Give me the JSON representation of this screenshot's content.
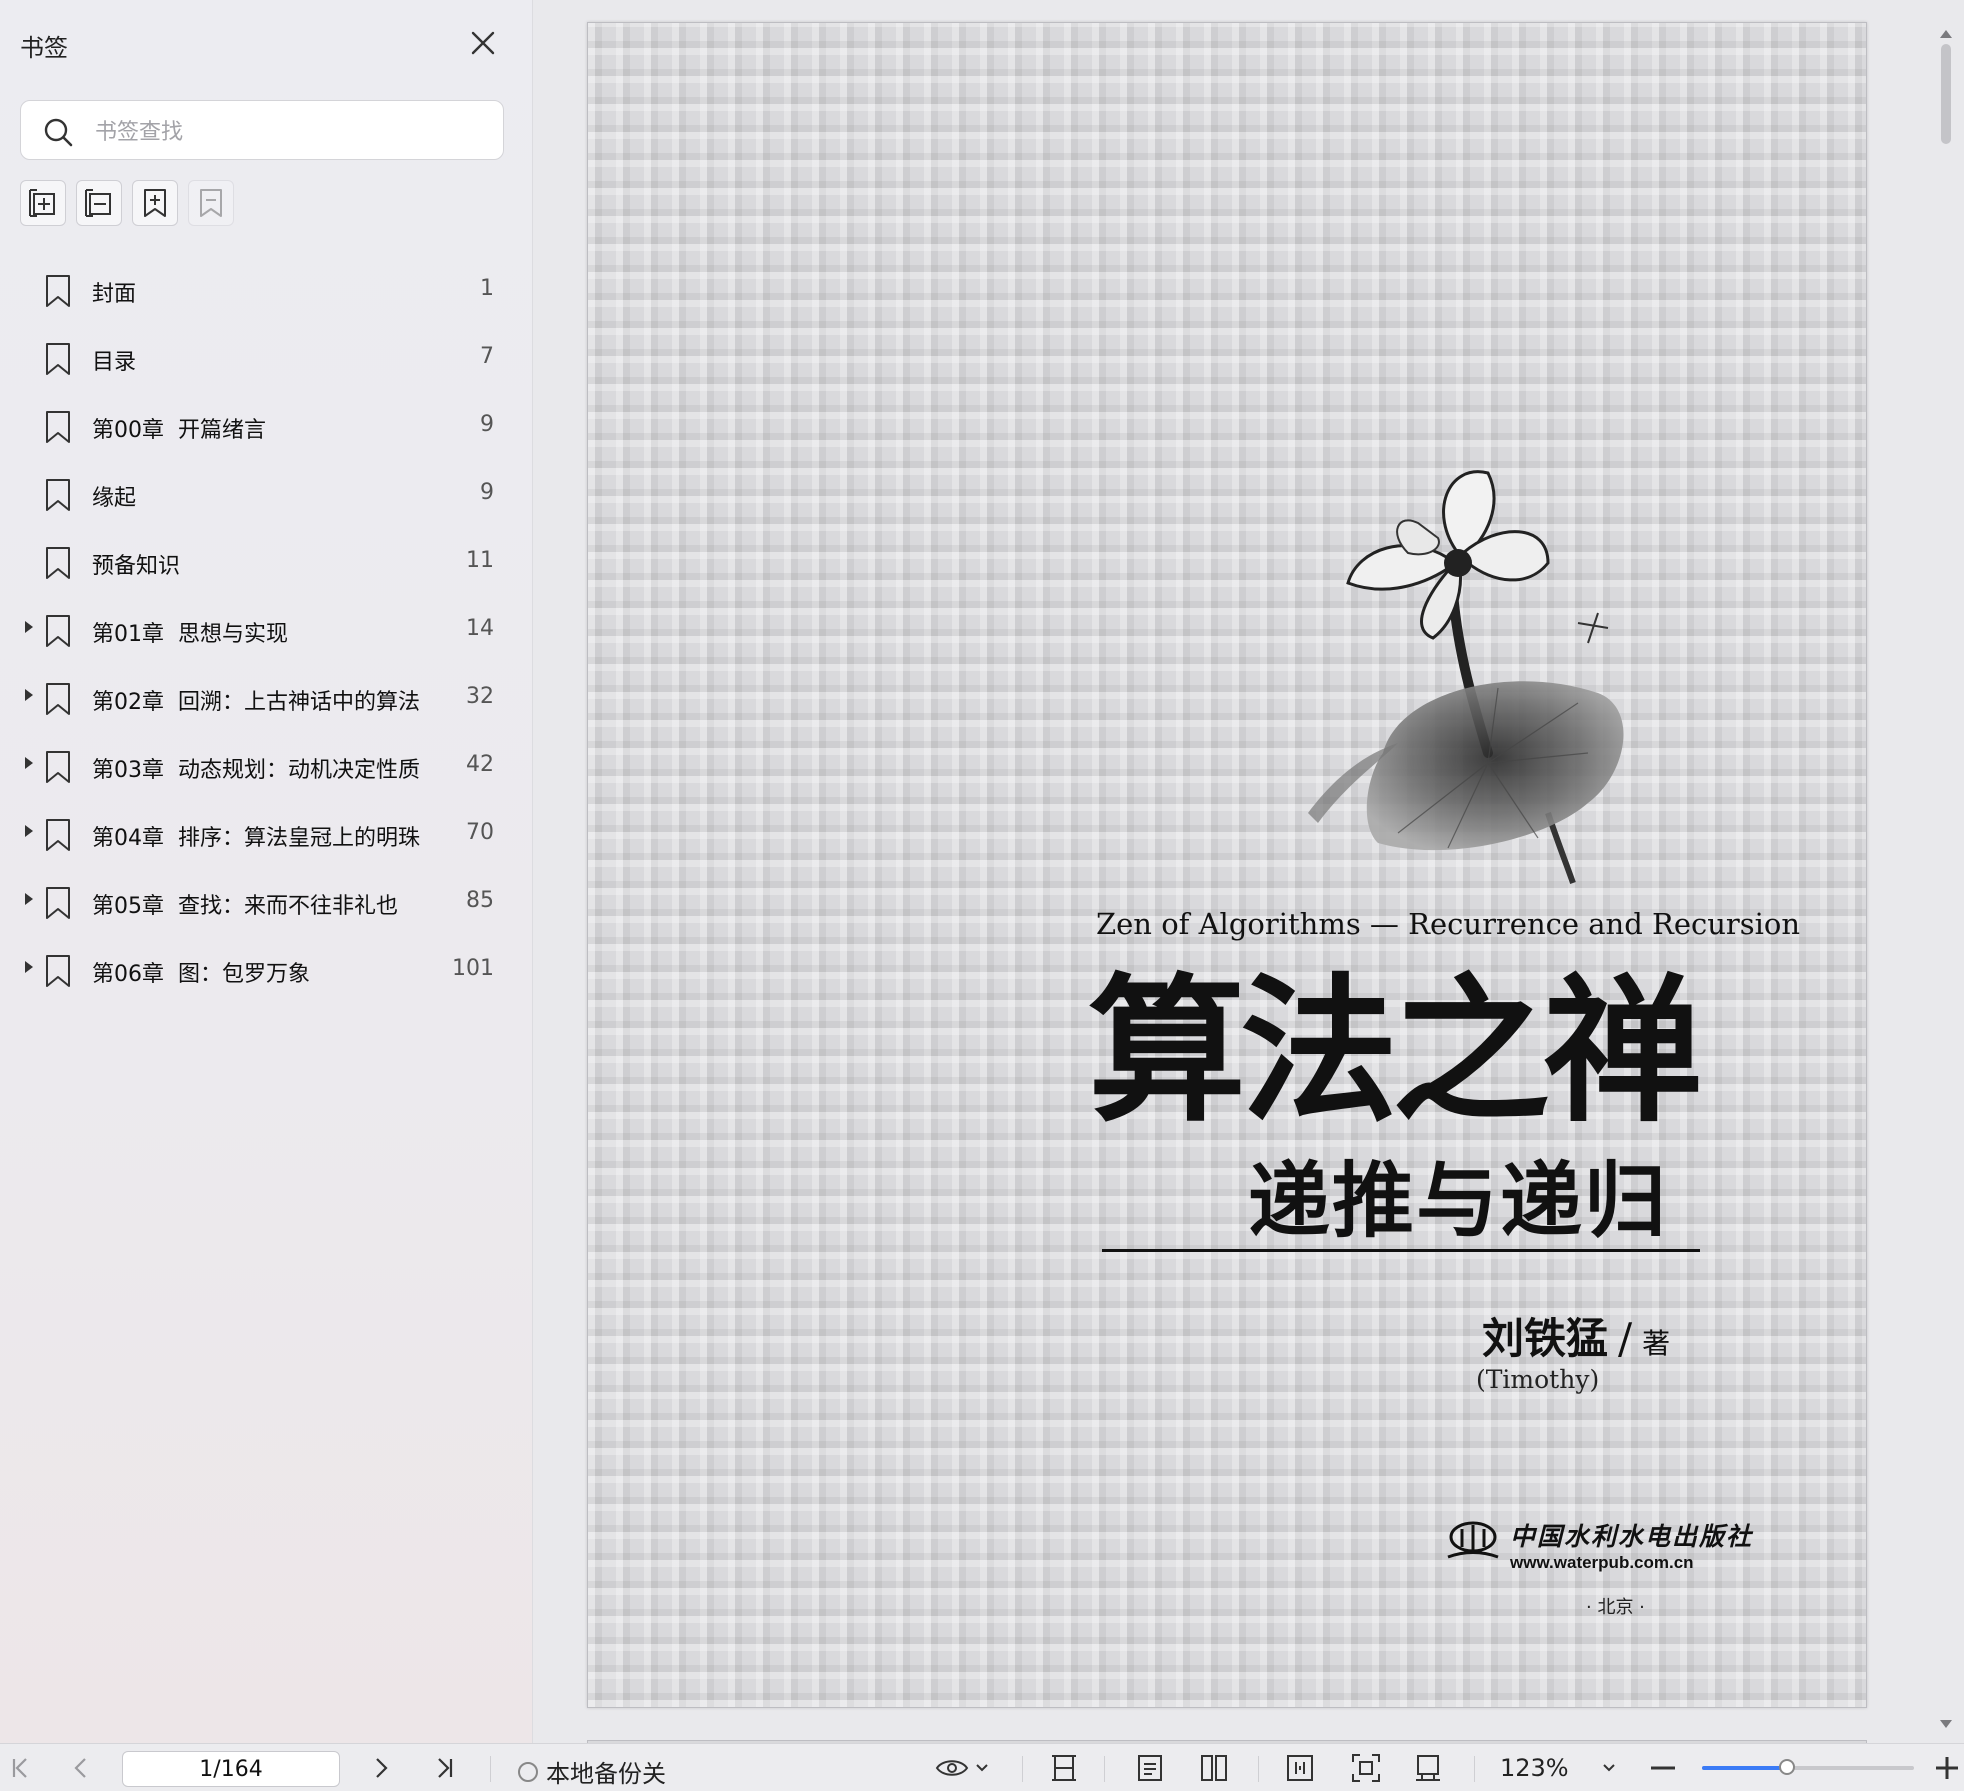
{
  "sidebar": {
    "title": "书签",
    "search_placeholder": "书签查找",
    "bookmarks": [
      {
        "label": "封面",
        "page": "1",
        "expandable": false
      },
      {
        "label": "目录",
        "page": "7",
        "expandable": false
      },
      {
        "label": "第00章  开篇绪言",
        "page": "9",
        "expandable": false
      },
      {
        "label": "缘起",
        "page": "9",
        "expandable": false
      },
      {
        "label": "预备知识",
        "page": "11",
        "expandable": false
      },
      {
        "label": "第01章  思想与实现",
        "page": "14",
        "expandable": true
      },
      {
        "label": "第02章  回溯：上古神话中的算法",
        "page": "32",
        "expandable": true
      },
      {
        "label": "第03章  动态规划：动机决定性质",
        "page": "42",
        "expandable": true
      },
      {
        "label": "第04章  排序：算法皇冠上的明珠",
        "page": "70",
        "expandable": true
      },
      {
        "label": "第05章  查找：来而不往非礼也",
        "page": "85",
        "expandable": true
      },
      {
        "label": "第06章  图：包罗万象",
        "page": "101",
        "expandable": true
      }
    ]
  },
  "document": {
    "title_en": "Zen of Algorithms — Recurrence and Recursion",
    "title_cn": "算法之禅",
    "subtitle_cn": "递推与递归",
    "author": "刘铁猛",
    "author_slash": "/",
    "author_role": "著",
    "author_en": "(Timothy)",
    "publisher": "中国水利水电出版社",
    "publisher_url": "www.waterpub.com.cn",
    "publisher_city": "· 北京 ·"
  },
  "bottombar": {
    "page_indicator": "1/164",
    "backup_label": "本地备份关",
    "zoom": "123%",
    "zoom_slider_fraction": 0.4
  },
  "colors": {
    "accent": "#3b7bf6",
    "page_bg": "#d9d9dc"
  }
}
